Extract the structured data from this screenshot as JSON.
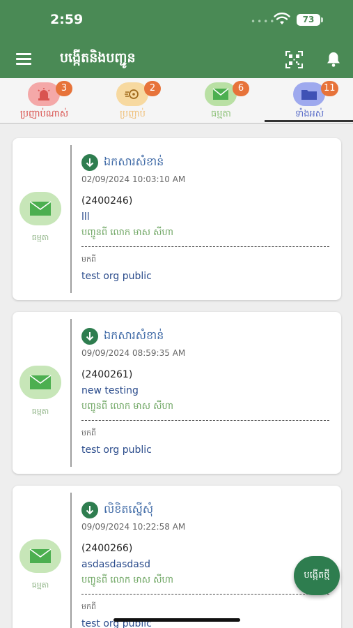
{
  "status_bar": {
    "time": "2:59",
    "battery": "73"
  },
  "header": {
    "title": "បង្កើតនិងបញ្ជូន"
  },
  "tabs": [
    {
      "label": "ប្រញាប់ណាស់",
      "badge": "3",
      "color": "#d9534f",
      "circle": "#f4a8a8",
      "icon": "siren-icon"
    },
    {
      "label": "ប្រញាប់",
      "badge": "2",
      "color": "#f0c07a",
      "circle": "#f7d9a0",
      "icon": "speed-icon"
    },
    {
      "label": "ធម្មតា",
      "badge": "6",
      "color": "#8fc27a",
      "circle": "#b9e0a4",
      "icon": "mail-icon"
    },
    {
      "label": "ទាំងអស់",
      "badge": "11",
      "color": "#5c6fc9",
      "circle": "#9ea9ee",
      "icon": "folder-icon"
    }
  ],
  "cards": [
    {
      "category_label": "ធម្មតា",
      "type_label": "ឯកសារសំខាន់",
      "date": "02/09/2024 10:03:10 AM",
      "id": "(2400246)",
      "subject": "lll",
      "sender": "បញ្ជូនពី លោក មាស សីហា",
      "from_label": "មកពី",
      "org": "test org public"
    },
    {
      "category_label": "ធម្មតា",
      "type_label": "ឯកសារសំខាន់",
      "date": "09/09/2024 08:59:35 AM",
      "id": "(2400261)",
      "subject": "new testing",
      "sender": "បញ្ជូនពី លោក មាស សីហា",
      "from_label": "មកពី",
      "org": "test org public"
    },
    {
      "category_label": "ធម្មតា",
      "type_label": "លិខិតស្នើសុំ",
      "date": "09/09/2024 10:22:58 AM",
      "id": "(2400266)",
      "subject": "asdasdasdasd",
      "sender": "បញ្ជូនពី លោក មាស សីហា",
      "from_label": "មកពី",
      "org": "test org public"
    }
  ],
  "fab": {
    "label": "បង្កើតថ្មី"
  },
  "colors": {
    "primary": "#4a8a55",
    "accent": "#2e7d4f",
    "badge": "#e7733a"
  }
}
